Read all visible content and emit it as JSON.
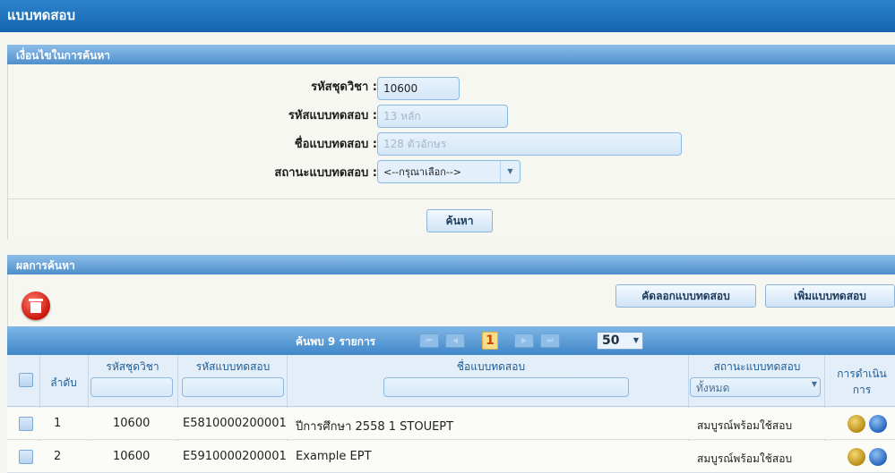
{
  "page": {
    "title": "แบบทดสอบ"
  },
  "search": {
    "section_title": "เงื่อนไขในการค้นหา",
    "course_code": {
      "label": "รหัสชุดวิชา :",
      "value": "10600"
    },
    "exam_code": {
      "label": "รหัสแบบทดสอบ :",
      "placeholder": "13 หลัก"
    },
    "exam_name": {
      "label": "ชื่อแบบทดสอบ :",
      "placeholder": "128 ตัวอักษร"
    },
    "exam_status": {
      "label": "สถานะแบบทดสอบ :",
      "selected": "<--กรุณาเลือก-->"
    },
    "search_button": "ค้นหา"
  },
  "results": {
    "section_title": "ผลการค้นหา",
    "copy_button": "คัดลอกแบบทดสอบ",
    "add_button": "เพิ่มแบบทดสอบ",
    "found_text": "ค้นพบ 9 รายการ",
    "current_page": "1",
    "page_size": "50",
    "columns": {
      "seq": "ลำดับ",
      "course_code": "รหัสชุดวิชา",
      "exam_code": "รหัสแบบทดสอบ",
      "exam_name": "ชื่อแบบทดสอบ",
      "status": "สถานะแบบทดสอบ",
      "actions_line1": "การดำเนิน",
      "actions_line2": "การ"
    },
    "status_filter": "ทั้งหมด",
    "rows": [
      {
        "seq": "1",
        "course_code": "10600",
        "exam_code": "E5810000200001",
        "exam_name": "ปีการศึกษา 2558 1 STOUEPT",
        "status": "สมบูรณ์พร้อมใช้สอบ"
      },
      {
        "seq": "2",
        "course_code": "10600",
        "exam_code": "E5910000200001",
        "exam_name": "Example EPT",
        "status": "สมบูรณ์พร้อมใช้สอบ"
      }
    ]
  }
}
